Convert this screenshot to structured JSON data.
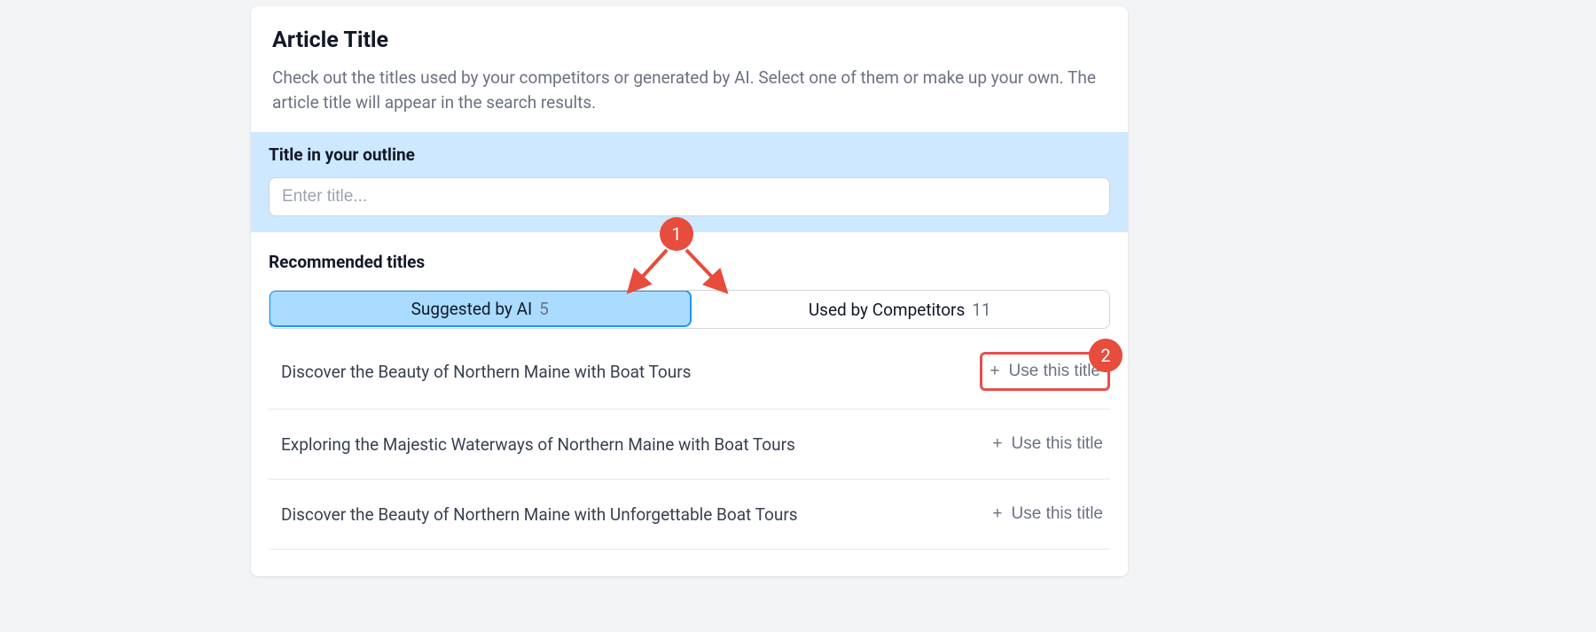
{
  "header": {
    "title": "Article Title",
    "desc": "Check out the titles used by your competitors or generated by AI. Select one of them or make up your own. The article title will appear in the search results."
  },
  "outline": {
    "label": "Title in your outline",
    "placeholder": "Enter title..."
  },
  "recommended": {
    "heading": "Recommended titles",
    "tabs": [
      {
        "label": "Suggested by AI",
        "count": "5",
        "active": true
      },
      {
        "label": "Used by Competitors",
        "count": "11",
        "active": false
      }
    ],
    "use_label": "Use this title",
    "titles": [
      "Discover the Beauty of Northern Maine with Boat Tours",
      "Exploring the Majestic Waterways of Northern Maine with Boat Tours",
      "Discover the Beauty of Northern Maine with Unforgettable Boat Tours"
    ]
  },
  "callouts": {
    "c1": "1",
    "c2": "2"
  },
  "colors": {
    "accent": "#e74c3c",
    "tab_active_bg": "#a9dcff",
    "outline_bg": "#cde8ff"
  }
}
